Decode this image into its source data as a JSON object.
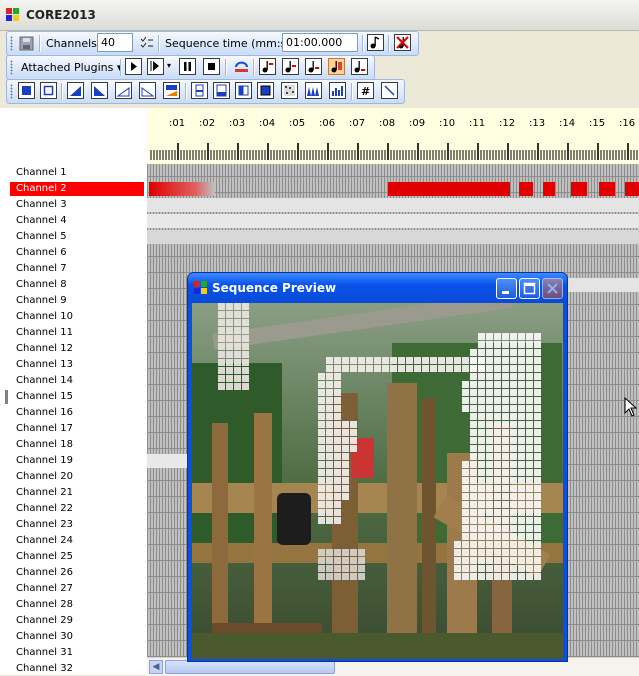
{
  "window": {
    "title": "CORE2013"
  },
  "toolbar1": {
    "channels_label": "Channels",
    "channels_value": "40",
    "seq_label": "Sequence time (mm:ss)",
    "seq_value": "01:00.000"
  },
  "toolbar2": {
    "plugins_label": "Attached Plugins ▾"
  },
  "timeline": {
    "labels": [
      ":01",
      ":02",
      ":03",
      ":04",
      ":05",
      ":06",
      ":07",
      ":08",
      ":09",
      ":10",
      ":11",
      ":12",
      ":13",
      ":14",
      ":15",
      ":16"
    ]
  },
  "channels": [
    "Channel 1",
    "Channel 2",
    "Channel 3",
    "Channel 4",
    "Channel 5",
    "Channel 6",
    "Channel 7",
    "Channel 8",
    "Channel 9",
    "Channel 10",
    "Channel 11",
    "Channel 12",
    "Channel 13",
    "Channel 14",
    "Channel 15",
    "Channel 16",
    "Channel 17",
    "Channel 18",
    "Channel 19",
    "Channel 20",
    "Channel 21",
    "Channel 22",
    "Channel 23",
    "Channel 24",
    "Channel 25",
    "Channel 26",
    "Channel 27",
    "Channel 28",
    "Channel 29",
    "Channel 30",
    "Channel 31",
    "Channel 32"
  ],
  "selected_channel": "Channel 2",
  "preview": {
    "title": "Sequence Preview"
  },
  "colors": {
    "selected": "#ff0000",
    "event_red": "#e00000",
    "window_blue": "#0a4fe0",
    "timeline_bg": "#ffffe1"
  }
}
